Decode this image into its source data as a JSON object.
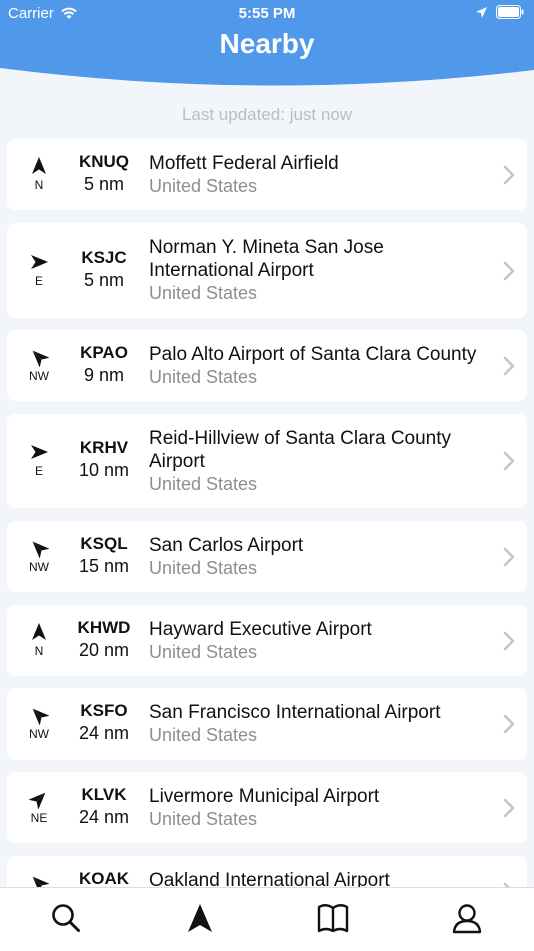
{
  "status": {
    "carrier": "Carrier",
    "time": "5:55 PM"
  },
  "header": {
    "title": "Nearby"
  },
  "updated": "Last updated: just now",
  "airports": [
    {
      "dir": "N",
      "code": "KNUQ",
      "dist": "5 nm",
      "name": [
        "Moffett Federal Airfield"
      ],
      "country": "United States"
    },
    {
      "dir": "E",
      "code": "KSJC",
      "dist": "5 nm",
      "name": [
        "Norman Y. Mineta San Jose",
        "International Airport"
      ],
      "country": "United States"
    },
    {
      "dir": "NW",
      "code": "KPAO",
      "dist": "9 nm",
      "name": [
        "Palo Alto Airport of Santa Clara County"
      ],
      "country": "United States"
    },
    {
      "dir": "E",
      "code": "KRHV",
      "dist": "10 nm",
      "name": [
        "Reid-Hillview of Santa Clara County",
        "Airport"
      ],
      "country": "United States"
    },
    {
      "dir": "NW",
      "code": "KSQL",
      "dist": "15 nm",
      "name": [
        "San Carlos Airport"
      ],
      "country": "United States"
    },
    {
      "dir": "N",
      "code": "KHWD",
      "dist": "20 nm",
      "name": [
        "Hayward Executive Airport"
      ],
      "country": "United States"
    },
    {
      "dir": "NW",
      "code": "KSFO",
      "dist": "24 nm",
      "name": [
        "San Francisco International Airport"
      ],
      "country": "United States"
    },
    {
      "dir": "NE",
      "code": "KLVK",
      "dist": "24 nm",
      "name": [
        "Livermore Municipal Airport"
      ],
      "country": "United States"
    },
    {
      "dir": "NW",
      "code": "KOAK",
      "dist": "",
      "name": [
        "Oakland International Airport"
      ],
      "country": ""
    }
  ],
  "tabs": [
    {
      "id": "search",
      "icon": "search-icon"
    },
    {
      "id": "nearby",
      "icon": "nearby-arrow-icon"
    },
    {
      "id": "logbook",
      "icon": "book-icon"
    },
    {
      "id": "profile",
      "icon": "profile-icon"
    }
  ],
  "colors": {
    "header": "#4f98ea",
    "background": "#f2f5f9"
  }
}
